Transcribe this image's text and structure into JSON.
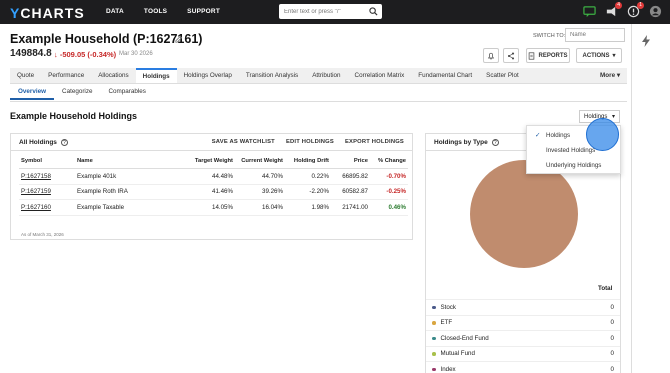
{
  "nav": {
    "logo_y": "Y",
    "logo_rest": "CHARTS",
    "links": [
      "DATA",
      "TOOLS",
      "SUPPORT"
    ],
    "search_placeholder": "Enter text or press \"/\"",
    "badges": {
      "announcements": "4",
      "notifications": "1"
    }
  },
  "header": {
    "title": "Example Household (P:1627161)",
    "price": "149884.8",
    "change": "-509.05 (-0.34%)",
    "date": "Mar 30 2026",
    "switch_to_label": "SWITCH TO:",
    "switch_to_placeholder": "Name",
    "reports_label": "REPORTS",
    "actions_label": "ACTIONS"
  },
  "tabs": [
    "Quote",
    "Performance",
    "Allocations",
    "Holdings",
    "Holdings Overlap",
    "Transition Analysis",
    "Attribution",
    "Correlation Matrix",
    "Fundamental Chart",
    "Scatter Plot"
  ],
  "tabs_more": "More",
  "active_tab": "Holdings",
  "subtabs": [
    "Overview",
    "Categorize",
    "Comparables"
  ],
  "section_title": "Example Household Holdings",
  "holdings_dropdown": {
    "selected": "Holdings",
    "options": [
      "Holdings",
      "Invested Holdings",
      "Underlying Holdings"
    ]
  },
  "all_holdings": {
    "title": "All Holdings",
    "help": "?",
    "actions": [
      "SAVE AS WATCHLIST",
      "EDIT HOLDINGS",
      "EXPORT HOLDINGS"
    ],
    "columns": {
      "symbol": "Symbol",
      "name": "Name",
      "target_weight": "Target Weight",
      "current_weight": "Current Weight",
      "holding_drift": "Holding Drift",
      "price": "Price",
      "pct_change": "% Change"
    },
    "rows": [
      {
        "symbol": "P:1627158",
        "name": "Example 401k",
        "target": "44.48%",
        "current": "44.70%",
        "drift": "0.22%",
        "price": "66895.82",
        "change": "-0.70%",
        "dir": "neg"
      },
      {
        "symbol": "P:1627159",
        "name": "Example Roth IRA",
        "target": "41.46%",
        "current": "39.26%",
        "drift": "-2.20%",
        "price": "60582.87",
        "change": "-0.25%",
        "dir": "neg"
      },
      {
        "symbol": "P:1627160",
        "name": "Example Taxable",
        "target": "14.05%",
        "current": "16.04%",
        "drift": "1.98%",
        "price": "21741.00",
        "change": "0.46%",
        "dir": "pos"
      }
    ],
    "as_of": "As of March 31, 2026"
  },
  "by_type": {
    "title": "Holdings by Type",
    "help": "?",
    "total_label": "Total",
    "pie_color": "#c08c6e",
    "types": [
      {
        "name": "Stock",
        "value": "0",
        "color": "#4a5a8a"
      },
      {
        "name": "ETF",
        "value": "0",
        "color": "#d9a640"
      },
      {
        "name": "Closed-End Fund",
        "value": "0",
        "color": "#3a8a8a"
      },
      {
        "name": "Mutual Fund",
        "value": "0",
        "color": "#a8c04a"
      },
      {
        "name": "Index",
        "value": "0",
        "color": "#9a3a6a"
      }
    ]
  }
}
